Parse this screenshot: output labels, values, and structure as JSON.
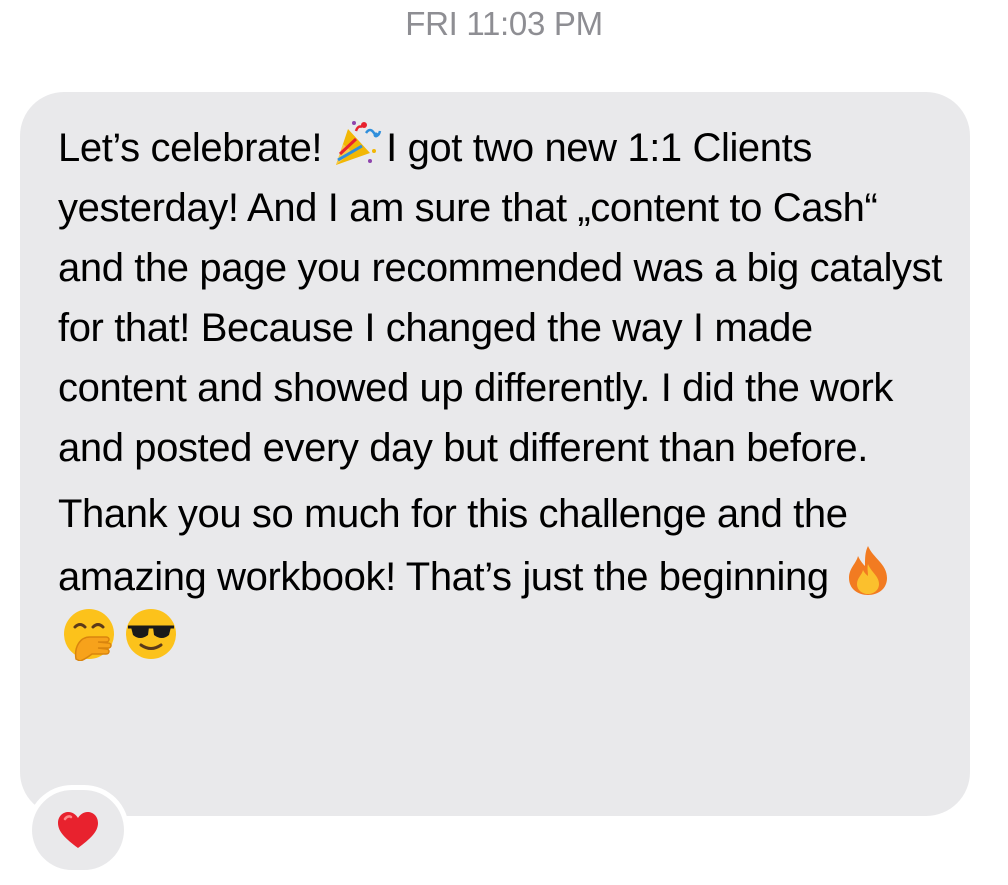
{
  "header": {
    "timestamp": "FRI 11:03 PM"
  },
  "message": {
    "p1_a": "Let’s celebrate!",
    "p1_emoji": "party-popper-icon",
    "p1_b": "I got two new 1:1 Clients yesterday! And I am sure that „content to Cash“ and the page you recommended was a big catalyst for that! Because I changed the way I made content and showed up differently. I did the work and posted every day but different than before.",
    "p2_a": "Thank you so much for this challenge and the amazing workbook! That’s just the beginning",
    "p2_emojis": [
      "fire-icon",
      "hand-over-mouth-face-icon",
      "sunglasses-face-icon"
    ]
  },
  "reaction": {
    "icon": "red-heart-icon",
    "color": "#e8222e"
  },
  "colors": {
    "bubble": "#e9e9eb",
    "timestamp": "#8e8e93",
    "text": "#000000"
  }
}
